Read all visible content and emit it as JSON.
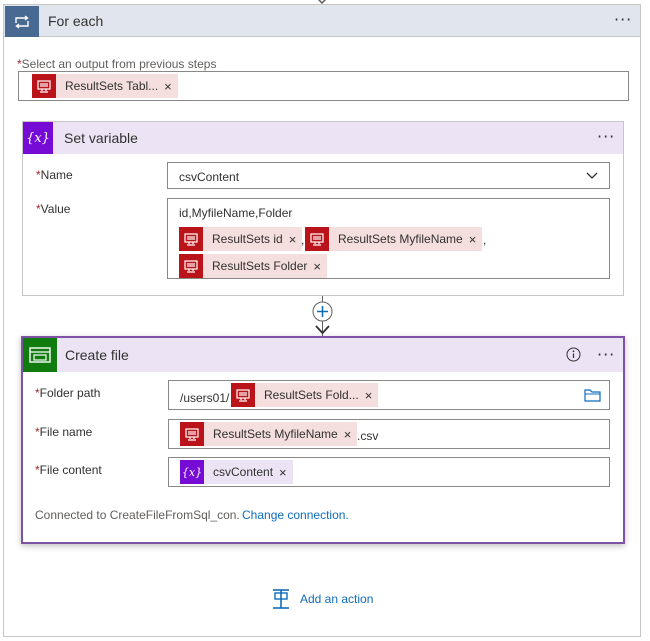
{
  "foreach": {
    "title": "For each",
    "more": "···",
    "output_label": "Select an output from previous steps",
    "required": "*",
    "output_token": "ResultSets Tabl...",
    "remove": "×"
  },
  "set_variable": {
    "title": "Set variable",
    "more": "···",
    "icon_text": "{x}",
    "name_label": "Name",
    "name_value": "csvContent",
    "value_label": "Value",
    "value_text": "id,MyfileName,Folder",
    "comma": ",",
    "tokens": [
      "ResultSets id",
      "ResultSets MyfileName",
      "ResultSets Folder"
    ]
  },
  "create_file": {
    "title": "Create file",
    "more": "···",
    "folder_label": "Folder path",
    "folder_prefix": "/users01/",
    "folder_token": "ResultSets Fold...",
    "filename_label": "File name",
    "filename_token": "ResultSets MyfileName",
    "filename_suffix": ".csv",
    "content_label": "File content",
    "content_token": "csvContent",
    "content_icon_text": "{x}",
    "connected_text": "Connected to CreateFileFromSql_con.",
    "change_connection": "Change connection."
  },
  "add_action": "Add an action",
  "colors": {
    "foreach_header": "#e1e6ee",
    "foreach_icon": "#486991",
    "variable_purple": "#770bd6",
    "sql_red": "#ba141a",
    "token_bg": "#f4dede",
    "file_green": "#107c10",
    "link_blue": "#0f6cbd"
  },
  "icons": [
    "loop-icon",
    "sql-icon",
    "variable-icon",
    "chevron-down-icon",
    "add-step-icon",
    "file-storage-icon",
    "info-icon",
    "folder-icon",
    "add-action-icon"
  ]
}
